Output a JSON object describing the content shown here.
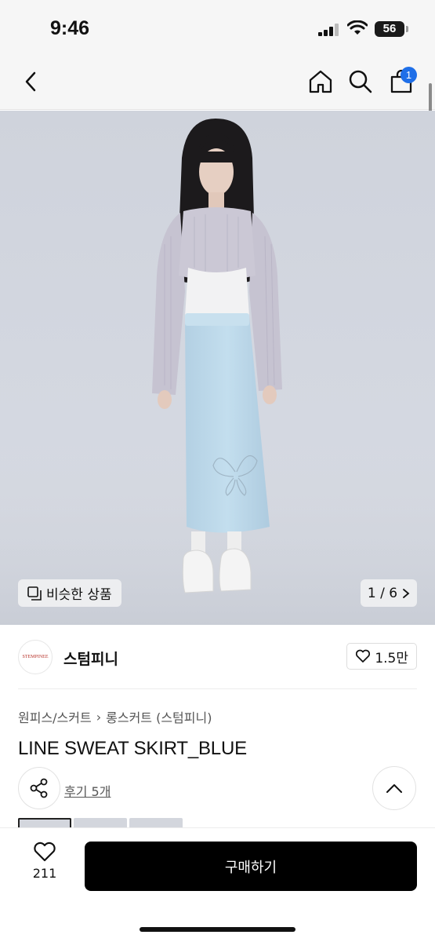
{
  "status": {
    "time": "9:46",
    "battery": "56"
  },
  "nav": {
    "cart_count": "1"
  },
  "hero": {
    "similar_label": "비슷한 상품",
    "counter": "1 / 6"
  },
  "brand": {
    "logo_text": "STEMPINEE",
    "name": "스텀피니",
    "likes": "1.5만"
  },
  "breadcrumb": {
    "category": "원피스/스커트",
    "subcategory": "롱스커트 (스텀피니)"
  },
  "product": {
    "title": "LINE SWEAT SKIRT_BLUE",
    "reviews": "후기 5개"
  },
  "bottom": {
    "wish_count": "211",
    "buy_label": "구매하기"
  },
  "colors": {
    "accent": "#1f6fe8",
    "buy_bg": "#000000",
    "hero_bg": "#d3d6de",
    "skirt": "#bcd8ea"
  }
}
